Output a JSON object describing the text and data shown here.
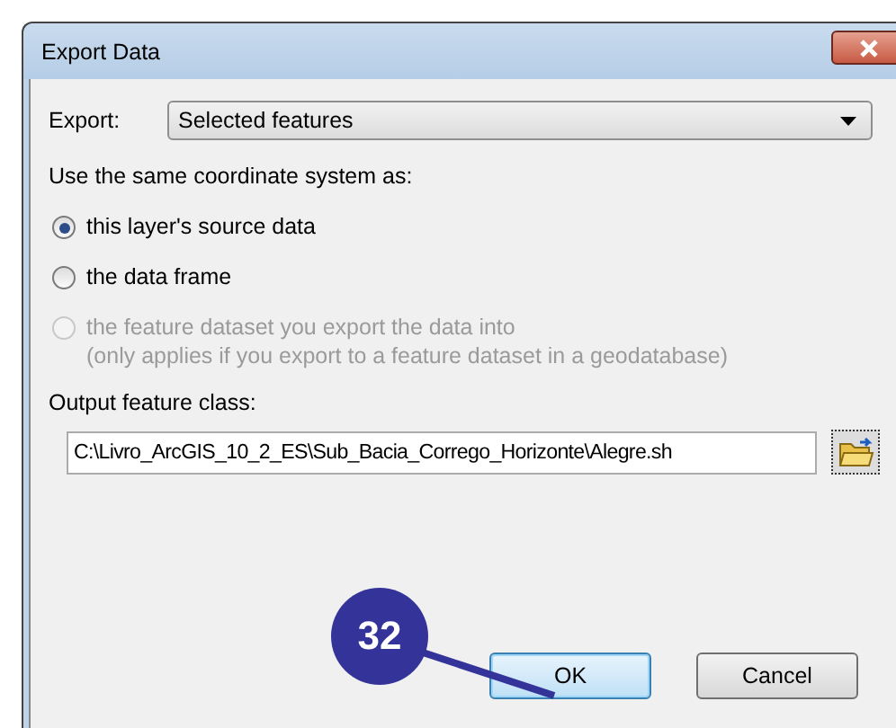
{
  "window": {
    "title": "Export Data"
  },
  "export": {
    "label": "Export:",
    "value": "Selected features"
  },
  "coordinate_system": {
    "label": "Use the same coordinate system as:",
    "options": [
      {
        "label": "this layer's source data",
        "selected": true,
        "disabled": false
      },
      {
        "label": "the data frame",
        "selected": false,
        "disabled": false
      },
      {
        "label": "the feature dataset you export the data into",
        "note": "(only applies if you export to a feature dataset in a geodatabase)",
        "selected": false,
        "disabled": true
      }
    ]
  },
  "output": {
    "label": "Output feature class:",
    "value": "C:\\Livro_ArcGIS_10_2_ES\\Sub_Bacia_Corrego_Horizonte\\Alegre.sh"
  },
  "buttons": [
    {
      "label": "OK",
      "default": true
    },
    {
      "label": "Cancel",
      "default": false
    }
  ],
  "callout": {
    "number": "32"
  }
}
